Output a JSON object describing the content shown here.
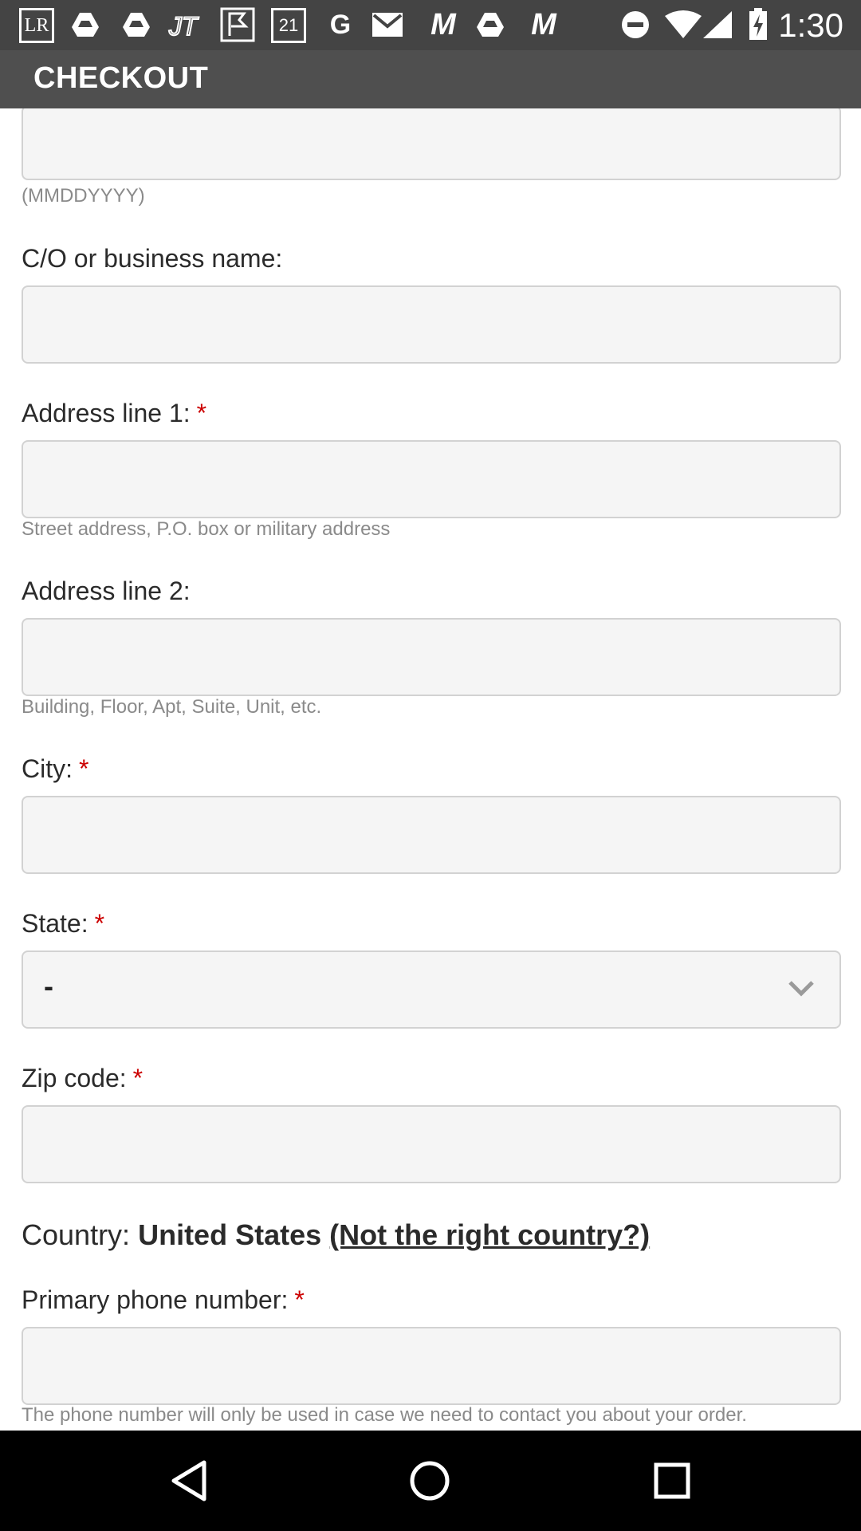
{
  "status_bar": {
    "time": "1:30",
    "notification_icons": [
      "LR",
      "G",
      "21",
      "M"
    ]
  },
  "app_bar": {
    "title": "CHECKOUT"
  },
  "form": {
    "dob_hint": "(MMDDYYYY)",
    "co_label": "C/O or business name:",
    "address1_label": "Address line 1:",
    "address1_hint": "Street address, P.O. box or military address",
    "address2_label": "Address line 2:",
    "address2_hint": "Building, Floor, Apt, Suite, Unit, etc.",
    "city_label": "City:",
    "state_label": "State:",
    "state_value": "-",
    "zip_label": "Zip code:",
    "country_label": "Country:",
    "country_value": "United States",
    "country_link": "(Not the right country?)",
    "phone_label": "Primary phone number:",
    "phone_hint": "The phone number will only be used in case we need to contact you about your order.",
    "required_marker": "*"
  },
  "colors": {
    "status_bar": "#444444",
    "app_bar": "#4f4f4f",
    "required": "#cc0000",
    "field_bg": "#f5f5f5",
    "field_border": "#d2d2d2"
  }
}
